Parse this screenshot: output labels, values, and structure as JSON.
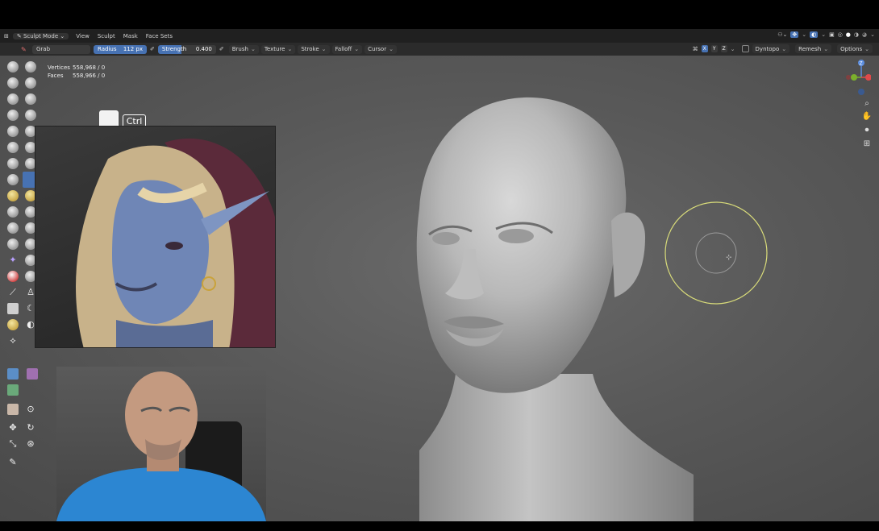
{
  "menubar": {
    "mode": "Sculpt Mode",
    "items": [
      "View",
      "Sculpt",
      "Mask",
      "Face Sets"
    ]
  },
  "toolbar": {
    "brush_name": "Grab",
    "radius_label": "Radius",
    "radius_value": "112 px",
    "strength_label": "Strength",
    "strength_value": "0.400",
    "menus": [
      "Brush",
      "Texture",
      "Stroke",
      "Falloff",
      "Cursor"
    ],
    "symmetry": [
      "X",
      "Y",
      "Z"
    ],
    "right_menus": [
      "Dyntopo",
      "Remesh",
      "Options"
    ]
  },
  "stats": {
    "vertices_label": "Vertices",
    "vertices_value": "558,968 / 0",
    "faces_label": "Faces",
    "faces_value": "558,966 / 0"
  },
  "overlay_keys": {
    "key2": "Ctrl"
  },
  "gizmo": {
    "z": "Z"
  },
  "colors": {
    "accent": "#4772b3",
    "brush_circle": "#d9dc7a",
    "viewport_bg": "#595959",
    "header_bg": "#202020"
  }
}
